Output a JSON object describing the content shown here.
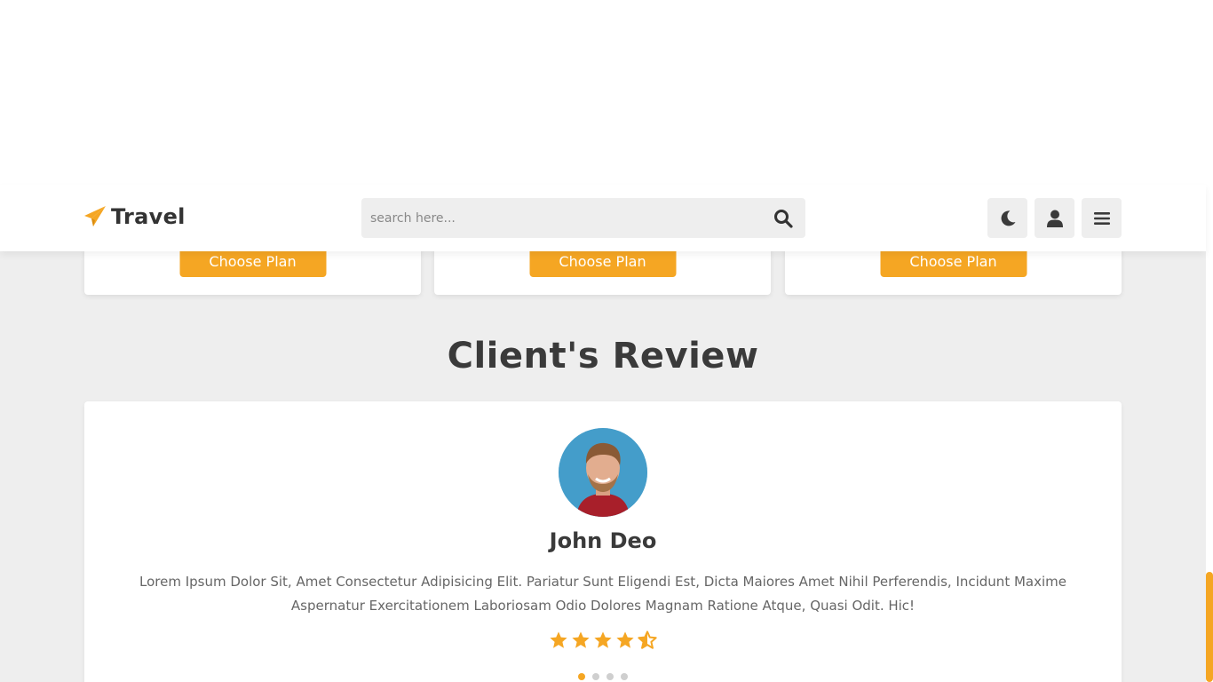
{
  "colors": {
    "accent": "#f5a623",
    "background": "#eeeeee",
    "text_dark": "#3a3a3a",
    "text_muted": "#666666"
  },
  "header": {
    "logo_icon": "paper-plane-icon",
    "logo_text": "Travel",
    "search": {
      "placeholder": "search here...",
      "value": "",
      "icon": "search-icon"
    },
    "buttons": [
      {
        "name": "theme-toggle",
        "icon": "moon-icon"
      },
      {
        "name": "login",
        "icon": "user-icon"
      },
      {
        "name": "menu",
        "icon": "bars-icon"
      }
    ]
  },
  "plans": [
    {
      "button_label": "Choose Plan"
    },
    {
      "button_label": "Choose Plan"
    },
    {
      "button_label": "Choose Plan"
    }
  ],
  "reviews_section": {
    "title_plain": "Client's",
    "title_accent": "Review",
    "review": {
      "name": "John Deo",
      "text": "Lorem Ipsum Dolor Sit, Amet Consectetur Adipisicing Elit. Pariatur Sunt Eligendi Est, Dicta Maiores Amet Nihil Perferendis, Incidunt Maxime Aspernatur Exercitationem Laboriosam Odio Dolores Magnam Ratione Atque, Quasi Odit. Hic!",
      "rating": 4.5,
      "rating_max": 5
    },
    "pagination": {
      "total": 4,
      "active_index": 0
    }
  }
}
